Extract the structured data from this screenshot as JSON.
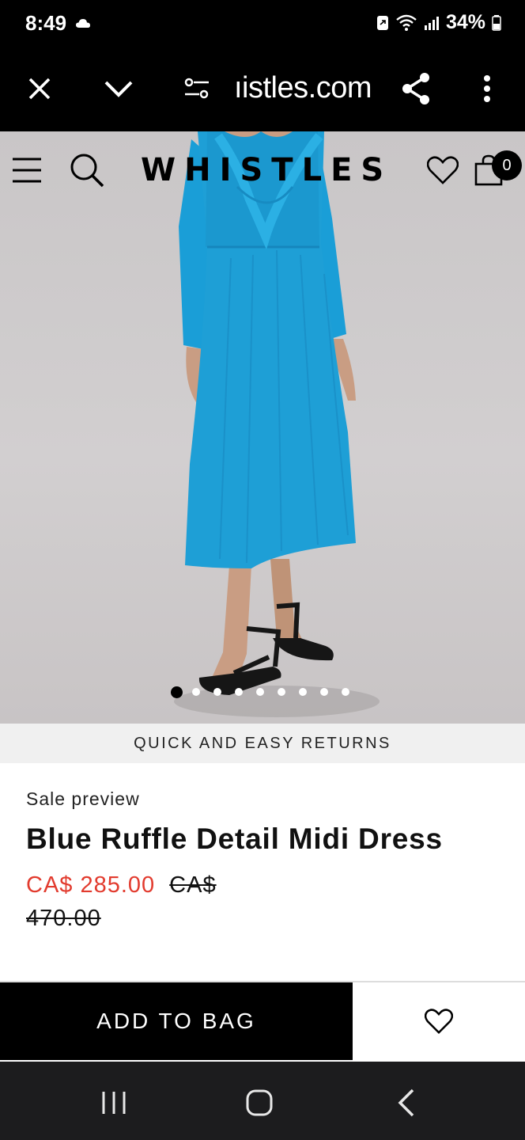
{
  "status_bar": {
    "time": "8:49",
    "battery": "34%"
  },
  "browser": {
    "url": "ıistles.com"
  },
  "site": {
    "logo": "WHISTLES",
    "bag_count": "0"
  },
  "gallery": {
    "total_images": 9,
    "active_index": 0
  },
  "banner": {
    "text": "QUICK AND EASY RETURNS"
  },
  "product": {
    "label": "Sale preview",
    "name": "Blue Ruffle Detail Midi Dress",
    "sale_price": "CA$ 285.00",
    "original_price": "CA$ 470.00"
  },
  "actions": {
    "add_to_bag": "ADD TO BAG"
  },
  "colors": {
    "dress": "#1e9fd6",
    "sale_price": "#e23b2e",
    "button_bg": "#000000"
  },
  "icons": [
    "close-icon",
    "chevron-down-icon",
    "tune-icon",
    "share-icon",
    "more-vert-icon",
    "menu-icon",
    "search-icon",
    "heart-icon",
    "bag-icon"
  ]
}
